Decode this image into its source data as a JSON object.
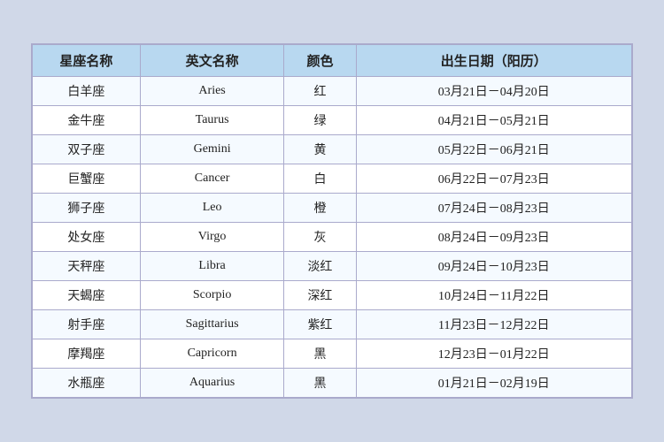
{
  "table": {
    "headers": [
      "星座名称",
      "英文名称",
      "颜色",
      "出生日期（阳历）"
    ],
    "rows": [
      {
        "zh": "白羊座",
        "en": "Aries",
        "color": "红",
        "date": "03月21日－04月20日"
      },
      {
        "zh": "金牛座",
        "en": "Taurus",
        "color": "绿",
        "date": "04月21日－05月21日"
      },
      {
        "zh": "双子座",
        "en": "Gemini",
        "color": "黄",
        "date": "05月22日－06月21日"
      },
      {
        "zh": "巨蟹座",
        "en": "Cancer",
        "color": "白",
        "date": "06月22日－07月23日"
      },
      {
        "zh": "狮子座",
        "en": "Leo",
        "color": "橙",
        "date": "07月24日－08月23日"
      },
      {
        "zh": "处女座",
        "en": "Virgo",
        "color": "灰",
        "date": "08月24日－09月23日"
      },
      {
        "zh": "天秤座",
        "en": "Libra",
        "color": "淡红",
        "date": "09月24日－10月23日"
      },
      {
        "zh": "天蝎座",
        "en": "Scorpio",
        "color": "深红",
        "date": "10月24日－11月22日"
      },
      {
        "zh": "射手座",
        "en": "Sagittarius",
        "color": "紫红",
        "date": "11月23日－12月22日"
      },
      {
        "zh": "摩羯座",
        "en": "Capricorn",
        "color": "黑",
        "date": "12月23日－01月22日"
      },
      {
        "zh": "水瓶座",
        "en": "Aquarius",
        "color": "黑",
        "date": "01月21日－02月19日"
      }
    ]
  }
}
